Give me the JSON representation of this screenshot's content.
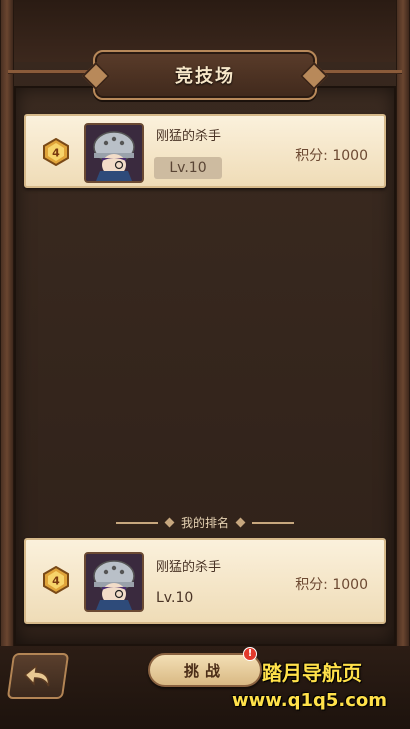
{
  "header": {
    "title": "竞技场"
  },
  "top_player": {
    "name": "刚猛的杀手",
    "level": "Lv.10",
    "score_label": "积分:",
    "score": "1000",
    "rank_icon": "rank-4-badge"
  },
  "my_rank": {
    "section_label": "我的排名",
    "name": "刚猛的杀手",
    "level": "Lv.10",
    "score_label": "积分:",
    "score": "1000",
    "rank_icon": "rank-4-badge"
  },
  "footer": {
    "back_icon": "return-arrow-icon",
    "challenge_label": "挑战",
    "notify_badge": "!"
  },
  "watermark": {
    "title": "踏月导航页",
    "url": "www.q1q5.com"
  },
  "colors": {
    "panel_bg": "#2f2119",
    "card_bg": "#fbf1dc",
    "accent_gold": "#b8895a",
    "watermark": "#ffe14a"
  }
}
